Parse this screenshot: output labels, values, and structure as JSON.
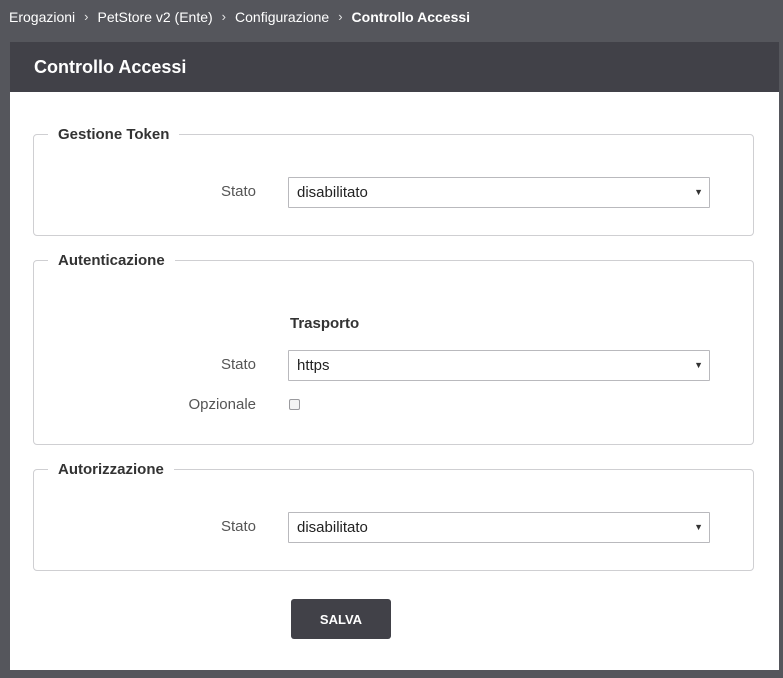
{
  "breadcrumb": {
    "items": [
      "Erogazioni",
      "PetStore v2 (Ente)",
      "Configurazione"
    ],
    "current": "Controllo Accessi",
    "separator": "›"
  },
  "panel": {
    "title": "Controllo Accessi"
  },
  "sections": {
    "gestione_token": {
      "legend": "Gestione Token",
      "stato_label": "Stato",
      "stato_value": "disabilitato"
    },
    "autenticazione": {
      "legend": "Autenticazione",
      "subheading": "Trasporto",
      "stato_label": "Stato",
      "stato_value": "https",
      "opzionale_label": "Opzionale",
      "opzionale_checked": false
    },
    "autorizzazione": {
      "legend": "Autorizzazione",
      "stato_label": "Stato",
      "stato_value": "disabilitato"
    }
  },
  "actions": {
    "save_label": "SALVA"
  },
  "icons": {
    "select_caret": "caret-down-icon",
    "breadcrumb_separator": "chevron-right-icon"
  },
  "colors": {
    "background": "#55565c",
    "header": "#414148",
    "button": "#414148",
    "panel": "#ffffff",
    "border": "#cfcfd2"
  }
}
